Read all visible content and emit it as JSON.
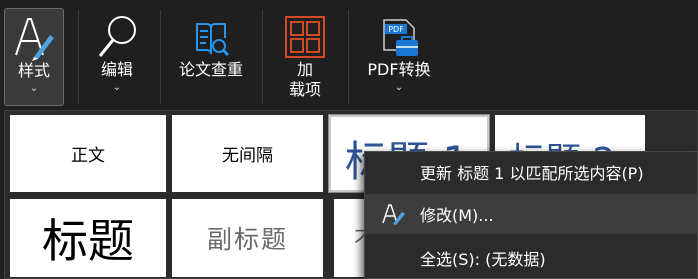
{
  "ribbon": {
    "styles_label": "样式",
    "editing_label": "编辑",
    "check_label": "论文查重",
    "addins_label_line1": "加",
    "addins_label_line2": "载项",
    "pdf_label": "PDF转换",
    "pdf_icon_text": "PDF",
    "chevron": "⌄"
  },
  "gallery": {
    "styles": [
      "正文",
      "无间隔",
      "标题 1",
      "标题 2",
      "标题",
      "副标题",
      "不"
    ]
  },
  "context_menu": {
    "items": [
      "更新 标题 1 以匹配所选内容(P)",
      "修改(M)...",
      "全选(S): (无数据)"
    ]
  },
  "colors": {
    "background": "#1f1f1f",
    "heading_blue": "#2f5496",
    "pdf_icon_blue": "#1976d2",
    "addins_orange": "#d14a22",
    "search_icon_blue": "#2196f3"
  }
}
